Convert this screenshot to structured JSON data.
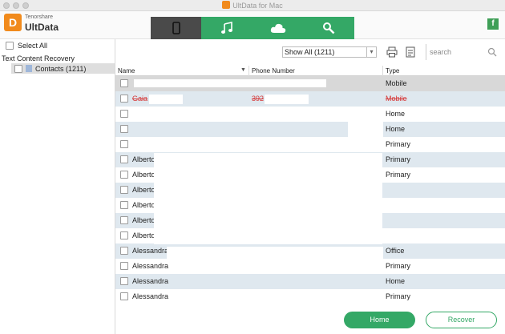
{
  "window": {
    "title": "UltData for Mac"
  },
  "brand": {
    "company": "Tenorshare",
    "product": "UltData",
    "logo_letter": "D"
  },
  "tabs": [
    {
      "name": "device",
      "icon": "phone-icon",
      "active": true
    },
    {
      "name": "music",
      "icon": "music-note-icon",
      "active": false
    },
    {
      "name": "cloud",
      "icon": "cloud-icon",
      "active": false
    },
    {
      "name": "repair",
      "icon": "wrench-icon",
      "active": false
    }
  ],
  "social": {
    "facebook_label": "f"
  },
  "sidebar": {
    "select_all": "Select All",
    "category": "Text Content Recovery",
    "items": [
      {
        "label": "Contacts (1211)"
      }
    ]
  },
  "toolbar": {
    "filter_value": "Show All (1211)",
    "search_placeholder": "search"
  },
  "table": {
    "columns": [
      "Name",
      "Phone Number",
      "Type"
    ],
    "rows": [
      {
        "name": "",
        "phone": "",
        "type": "Mobile",
        "style": "grey",
        "deleted": false
      },
      {
        "name": "Gaia",
        "phone": "392",
        "type": "Mobile",
        "style": "blue",
        "deleted": true
      },
      {
        "name": "",
        "phone": "",
        "type": "Home",
        "style": "white",
        "deleted": false
      },
      {
        "name": "",
        "phone": "",
        "type": "Home",
        "style": "blue",
        "deleted": false
      },
      {
        "name": "",
        "phone": "",
        "type": "Primary",
        "style": "white",
        "deleted": false
      },
      {
        "name": "Alberto",
        "phone": "",
        "type": "Primary",
        "style": "blue",
        "deleted": false
      },
      {
        "name": "Alberto",
        "phone": "",
        "type": "Primary",
        "style": "white",
        "deleted": false
      },
      {
        "name": "Alberto",
        "phone": "",
        "type": "",
        "style": "blue",
        "deleted": false
      },
      {
        "name": "Alberto",
        "phone": "",
        "type": "",
        "style": "white",
        "deleted": false
      },
      {
        "name": "Alberto",
        "phone": "",
        "type": "",
        "style": "blue",
        "deleted": false
      },
      {
        "name": "Alberto",
        "phone": "",
        "type": "",
        "style": "white",
        "deleted": false
      },
      {
        "name": "Alessandra",
        "phone": "",
        "type": "Office",
        "style": "blue",
        "deleted": false
      },
      {
        "name": "Alessandra",
        "phone": "",
        "type": "Primary",
        "style": "white",
        "deleted": false
      },
      {
        "name": "Alessandra",
        "phone": "",
        "type": "Home",
        "style": "blue",
        "deleted": false
      },
      {
        "name": "Alessandra",
        "phone": "",
        "type": "Primary",
        "style": "white",
        "deleted": false
      }
    ]
  },
  "footer": {
    "home_label": "Home",
    "recover_label": "Recover"
  },
  "colors": {
    "accent": "#34a866",
    "logo": "#f18a1c",
    "active_tab": "#4a4a4a",
    "row_highlight": "#dfe8ef",
    "deleted_text": "#d63a3a"
  }
}
